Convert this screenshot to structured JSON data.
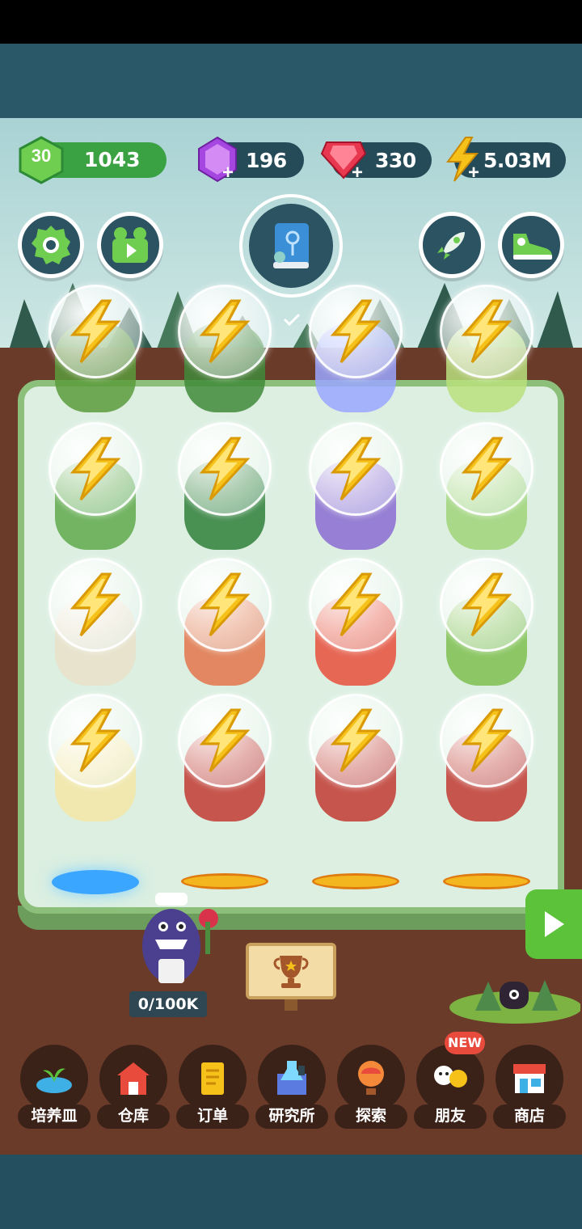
{
  "resources": {
    "level": "30",
    "coins": "1043",
    "gems": "196",
    "rubies": "330",
    "energy": "5.03M"
  },
  "buttons": {
    "settings_icon": "gear-icon",
    "video_icon": "video-icon",
    "journal_icon": "flower-book-icon",
    "rocket_icon": "rocket-icon",
    "shoe_icon": "sneaker-icon"
  },
  "garden": {
    "bubble_icon": "lightning-bolt-icon",
    "rows": 4,
    "cols": 4
  },
  "progress": "0/100K",
  "nav": [
    {
      "label": "培养皿",
      "icon": "petri-dish-icon"
    },
    {
      "label": "仓库",
      "icon": "barn-icon"
    },
    {
      "label": "订单",
      "icon": "scroll-icon"
    },
    {
      "label": "研究所",
      "icon": "lab-icon"
    },
    {
      "label": "探索",
      "icon": "balloon-icon"
    },
    {
      "label": "朋友",
      "icon": "friends-icon"
    },
    {
      "label": "商店",
      "icon": "shop-icon"
    }
  ],
  "badge": "NEW",
  "colors": {
    "accent_green": "#3aa243",
    "panel_dark": "#264b58",
    "badge_red": "#e84a3c",
    "bolt_yellow": "#f6c21a"
  }
}
